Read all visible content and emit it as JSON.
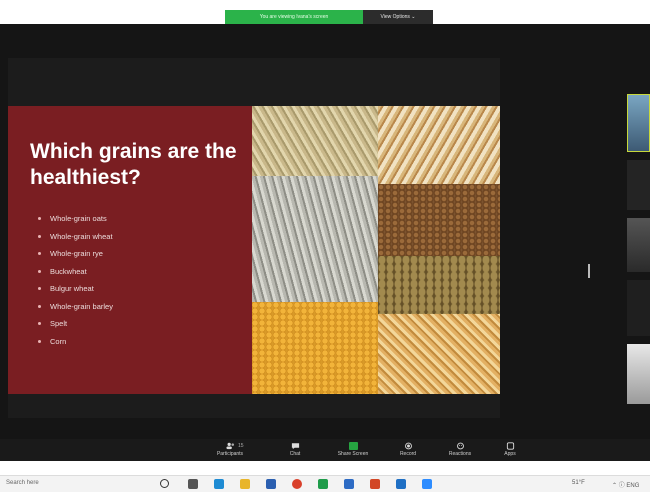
{
  "banner": {
    "message": "You are viewing Ivana's screen",
    "options_label": "View Options ⌄"
  },
  "slide": {
    "title": "Which grains are the healthiest?",
    "items": [
      "Whole-grain oats",
      "Whole-grain wheat",
      "Whole-grain rye",
      "Buckwheat",
      "Bulgur wheat",
      "Whole-grain barley",
      "Spelt",
      "Corn"
    ]
  },
  "toolbar": {
    "participants_label": "Participants",
    "participants_count": "15",
    "chat_label": "Chat",
    "share_label": "Share Screen",
    "record_label": "Record",
    "reactions_label": "Reactions",
    "apps_label": "Apps"
  },
  "taskbar": {
    "search_text": "Search here",
    "weather": "51°F",
    "tray": "⌃ ⓘ ENG"
  },
  "colors": {
    "slide_red": "#7a1e22",
    "share_green": "#2bb34a",
    "toolbar_bg": "#1a1a1a"
  }
}
